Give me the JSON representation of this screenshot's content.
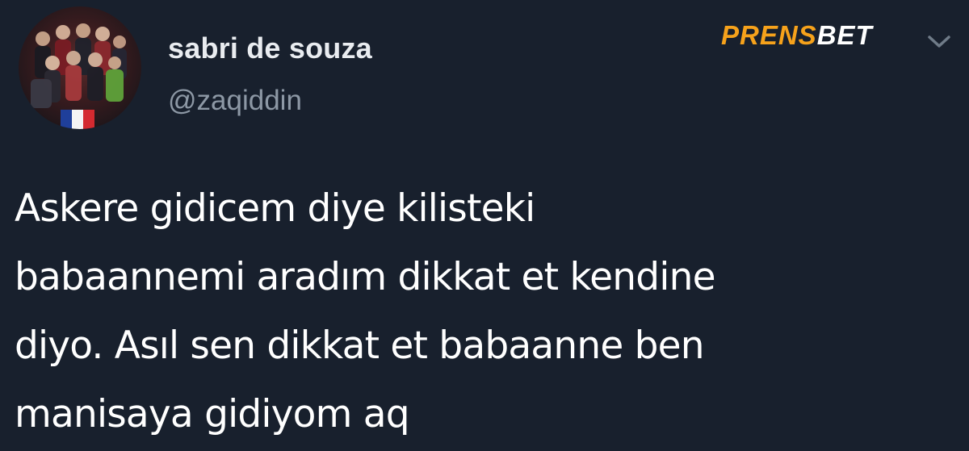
{
  "author": {
    "display_name": "sabri de souza",
    "handle": "@zaqiddin",
    "avatar_flag": "France"
  },
  "brand": {
    "part_a": "PRENS",
    "part_b": "BET"
  },
  "tweet": {
    "lines": [
      "Askere gidicem diye kilisteki",
      "babaannemi aradım dikkat et kendine",
      "diyo. Asıl sen dikkat et babaanne ben",
      "manisaya gidiyom aq"
    ]
  },
  "icons": {
    "menu": "chevron-down-icon"
  },
  "colors": {
    "background": "#18202d",
    "name": "#e9ecf0",
    "handle": "#8d98a5",
    "brand_accent": "#f6a21b"
  }
}
